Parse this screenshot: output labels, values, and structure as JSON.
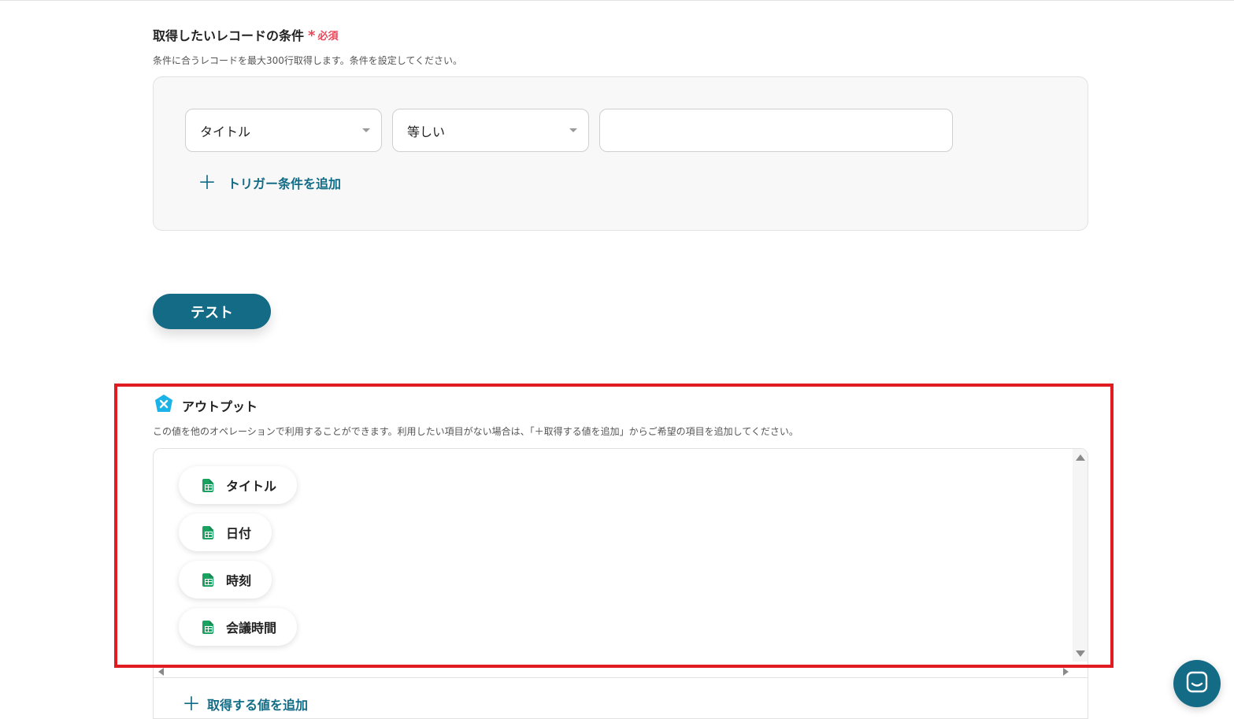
{
  "conditions": {
    "title": "取得したいレコードの条件",
    "required_mark": "*",
    "required_label": "必須",
    "description": "条件に合うレコードを最大300行取得します。条件を設定してください。",
    "field_select": {
      "value": "タイトル"
    },
    "operator_select": {
      "value": "等しい"
    },
    "value_input": {
      "value": ""
    },
    "add_condition_icon": "plus-icon",
    "add_condition_label": "トリガー条件を追加"
  },
  "test_button_label": "テスト",
  "output": {
    "icon": "yoom-x-icon",
    "title": "アウトプット",
    "description": "この値を他のオペレーションで利用することができます。利用したい項目がない場合は、「＋取得する値を追加」からご希望の項目を追加してください。",
    "items": [
      {
        "label": "タイトル",
        "icon": "spreadsheet-icon"
      },
      {
        "label": "日付",
        "icon": "spreadsheet-icon"
      },
      {
        "label": "時刻",
        "icon": "spreadsheet-icon"
      },
      {
        "label": "会議時間",
        "icon": "spreadsheet-icon"
      }
    ],
    "add_value_label": "取得する値を追加"
  },
  "chat_widget": {
    "icon": "chat-icon"
  },
  "colors": {
    "accent": "#136b85",
    "required": "#e8465a",
    "highlight": "#e01b22",
    "sheet_green": "#1aa260",
    "output_icon": "#1ab3e8"
  }
}
